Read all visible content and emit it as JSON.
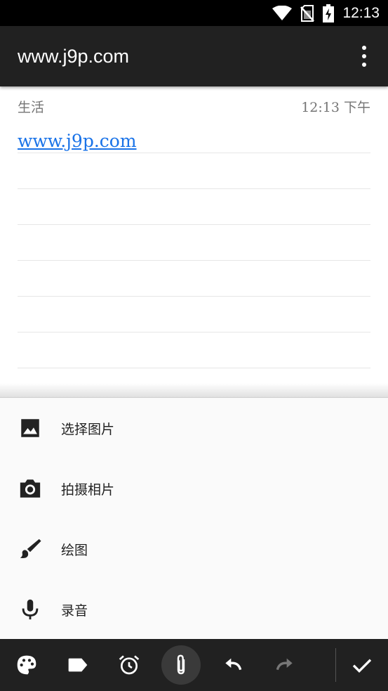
{
  "status_bar": {
    "time": "12:13",
    "icons": [
      "wifi-icon",
      "no-sim-icon",
      "battery-charging-icon"
    ]
  },
  "app_bar": {
    "title": "www.j9p.com",
    "menu_icon": "overflow-menu-icon"
  },
  "note": {
    "category": "生活",
    "timestamp": "12:13 下午",
    "link_text": "www.j9p.com",
    "link_color": "#1a73e8"
  },
  "attach_menu": {
    "items": [
      {
        "label": "选择图片",
        "icon": "image-icon"
      },
      {
        "label": "拍摄相片",
        "icon": "camera-icon"
      },
      {
        "label": "绘图",
        "icon": "brush-icon"
      },
      {
        "label": "录音",
        "icon": "microphone-icon"
      }
    ]
  },
  "toolbar": {
    "buttons": [
      {
        "name": "color-palette-button",
        "icon": "palette-icon"
      },
      {
        "name": "label-button",
        "icon": "label-icon"
      },
      {
        "name": "reminder-button",
        "icon": "alarm-icon"
      },
      {
        "name": "attach-button",
        "icon": "paperclip-icon",
        "active": true
      },
      {
        "name": "undo-button",
        "icon": "undo-icon"
      },
      {
        "name": "redo-button",
        "icon": "redo-icon",
        "disabled": true
      },
      {
        "name": "done-button",
        "icon": "check-icon"
      }
    ]
  },
  "colors": {
    "status_bar": "#000000",
    "app_bar": "#212121",
    "toolbar": "#212121",
    "sheet": "#fafafa"
  }
}
